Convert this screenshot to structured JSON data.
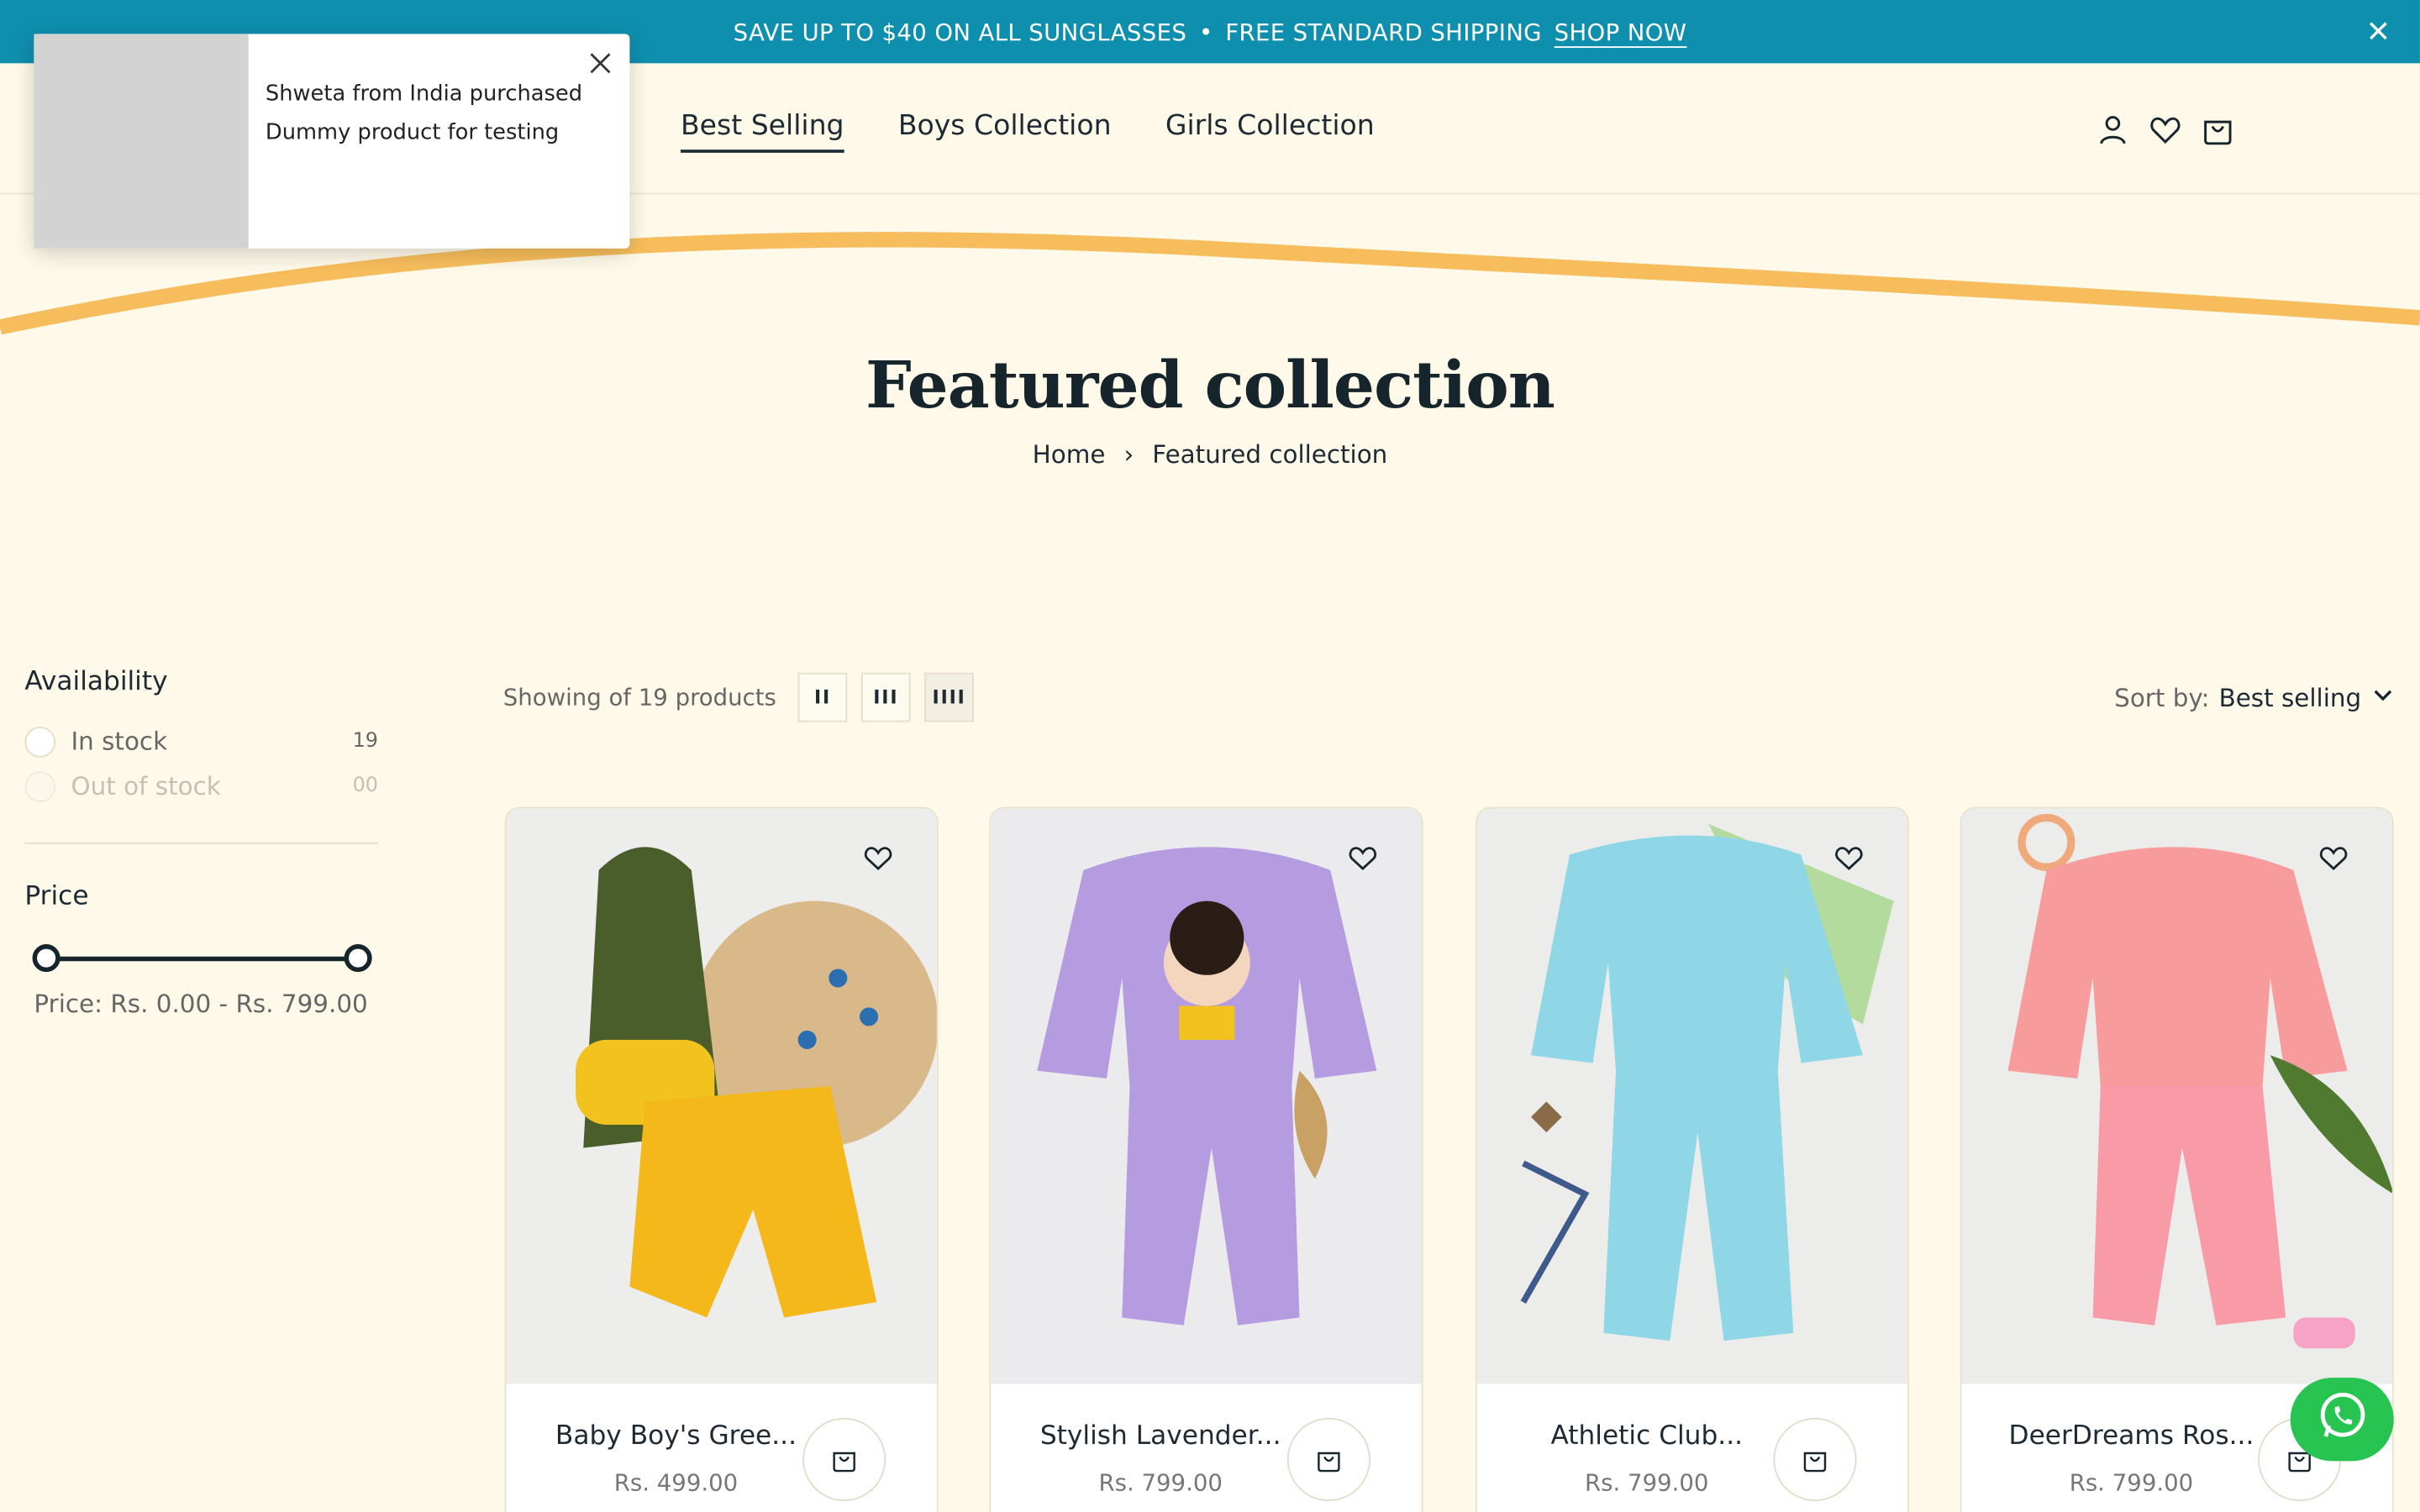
{
  "announcement": {
    "text": "SAVE UP TO $40 ON ALL SUNGLASSES",
    "separator": "•",
    "text2": "FREE STANDARD SHIPPING",
    "link": "SHOP NOW"
  },
  "nav": {
    "items": [
      {
        "label": "Best Selling",
        "active": true
      },
      {
        "label": "Boys Collection",
        "active": false
      },
      {
        "label": "Girls Collection",
        "active": false
      }
    ]
  },
  "popup": {
    "line1": "Shweta from India purchased",
    "line2": "Dummy product for testing"
  },
  "page": {
    "title": "Featured collection",
    "breadcrumb": {
      "home": "Home",
      "separator": "›",
      "current": "Featured collection"
    }
  },
  "filters": {
    "availability": {
      "title": "Availability",
      "options": [
        {
          "label": "In stock",
          "count": "19"
        },
        {
          "label": "Out of stock",
          "count": "00"
        }
      ]
    },
    "price": {
      "title": "Price",
      "label": "Price:",
      "range": "Rs. 0.00 - Rs. 799.00",
      "min": 0,
      "max": 799
    }
  },
  "toolbar": {
    "showing": "Showing of 19 products",
    "grid_options": [
      "II",
      "III",
      "IIII"
    ],
    "sort_label": "Sort by:",
    "sort_value": "Best selling"
  },
  "products": [
    {
      "name": "Baby Boy's Gree...",
      "price": "Rs. 499.00"
    },
    {
      "name": "Stylish Lavender...",
      "price": "Rs. 799.00"
    },
    {
      "name": "Athletic Club...",
      "price": "Rs. 799.00"
    },
    {
      "name": "DeerDreams Ros...",
      "price": "Rs. 799.00"
    }
  ],
  "colors": {
    "announcement_bg": "#0f8fae",
    "page_bg": "#fef9e8",
    "wave": "#f7bd5c",
    "whatsapp": "#27c451"
  }
}
